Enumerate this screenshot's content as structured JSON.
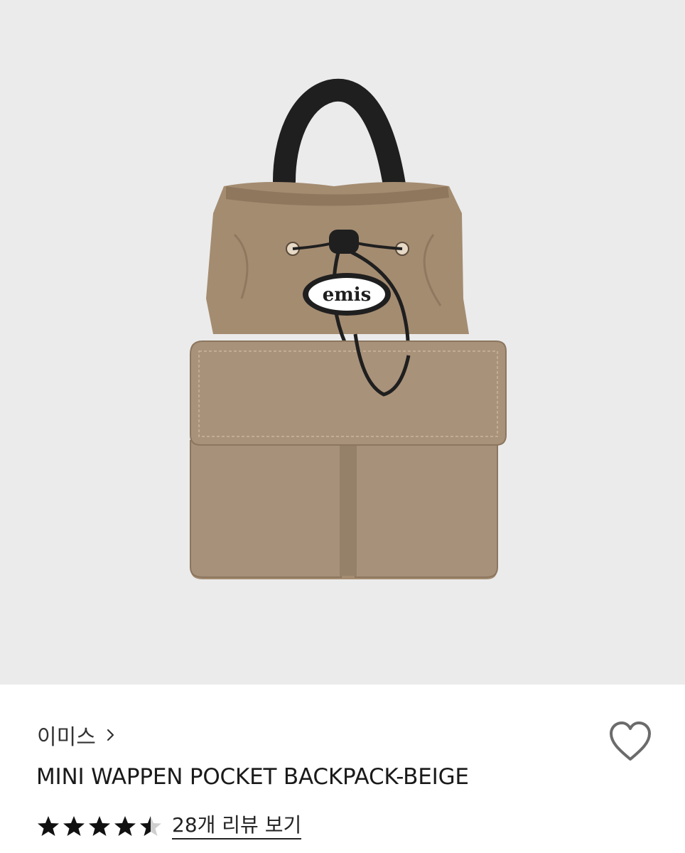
{
  "product": {
    "brand": "이미스",
    "title": "MINI WAPPEN POCKET BACKPACK-BEIGE",
    "image_alt": "emis mini wappen pocket backpack in beige",
    "patch_text": "emis",
    "rating": 4.5,
    "rating_max": 5,
    "reviews_label": "28개 리뷰 보기"
  },
  "icons": {
    "brand_chevron": "chevron-right-icon",
    "wishlist": "heart-outline-icon",
    "star": "star-icon"
  },
  "colors": {
    "image_background": "#ebebeb",
    "bag_beige": "#a48c71",
    "strap_black": "#1f1f1f",
    "text": "#1a1a1a",
    "heart_outline": "#6b6b6b"
  }
}
